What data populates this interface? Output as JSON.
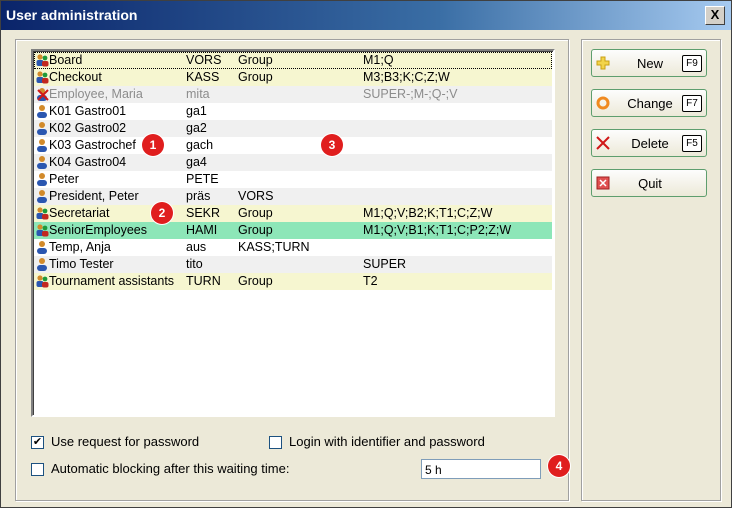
{
  "window": {
    "title": "User administration",
    "close_glyph": "X"
  },
  "users": [
    {
      "name": "Board",
      "id": "VORS",
      "type": "Group",
      "rights": "M1;Q",
      "icon": "group-icon",
      "style": "g",
      "sel": true
    },
    {
      "name": "Checkout",
      "id": "KASS",
      "type": "Group",
      "rights": "M3;B3;K;C;Z;W",
      "icon": "group-icon",
      "style": "g"
    },
    {
      "name": "Employee, Maria",
      "id": "mita",
      "type": "",
      "rights": "SUPER-;M-;Q-;V",
      "icon": "blocked-user-icon",
      "style": "s",
      "disabled": true
    },
    {
      "name": "K01 Gastro01",
      "id": "ga1",
      "type": "",
      "rights": "",
      "icon": "user-icon",
      "style": ""
    },
    {
      "name": "K02 Gastro02",
      "id": "ga2",
      "type": "",
      "rights": "",
      "icon": "user-icon",
      "style": "s"
    },
    {
      "name": "K03 Gastrochef",
      "id": "gach",
      "type": "",
      "rights": "",
      "icon": "user-icon",
      "style": ""
    },
    {
      "name": "K04 Gastro04",
      "id": "ga4",
      "type": "",
      "rights": "",
      "icon": "user-icon",
      "style": "s"
    },
    {
      "name": "Peter",
      "id": "PETE",
      "type": "",
      "rights": "",
      "icon": "user-icon",
      "style": ""
    },
    {
      "name": "President, Peter",
      "id": "präs",
      "type": "VORS",
      "rights": "",
      "icon": "user-icon",
      "style": "s"
    },
    {
      "name": "Secretariat",
      "id": "SEKR",
      "type": "Group",
      "rights": "M1;Q;V;B2;K;T1;C;Z;W",
      "icon": "group-icon",
      "style": "g"
    },
    {
      "name": "SeniorEmployees",
      "id": "HAMI",
      "type": "Group",
      "rights": "M1;Q;V;B1;K;T1;C;P2;Z;W",
      "icon": "group-icon",
      "style": "gr"
    },
    {
      "name": "Temp, Anja",
      "id": "aus",
      "type": "KASS;TURN",
      "rights": "",
      "icon": "user-icon",
      "style": ""
    },
    {
      "name": "Timo Tester",
      "id": "tito",
      "type": "",
      "rights": "SUPER",
      "icon": "user-icon",
      "style": "s"
    },
    {
      "name": "Tournament assistants",
      "id": "TURN",
      "type": "Group",
      "rights": "T2",
      "icon": "group-icon",
      "style": "g"
    }
  ],
  "badges": [
    "1",
    "2",
    "3",
    "4"
  ],
  "options": {
    "use_request_password": {
      "label": "Use request for password",
      "checked": true
    },
    "login_identifier": {
      "label": "Login with identifier and password",
      "checked": false
    },
    "auto_blocking": {
      "label": "Automatic blocking after this waiting time:",
      "checked": false
    },
    "wait_time": "5 h"
  },
  "buttons": {
    "new": {
      "label": "New",
      "key": "F9",
      "icon": "plus-icon"
    },
    "change": {
      "label": "Change",
      "key": "F7",
      "icon": "change-icon"
    },
    "delete": {
      "label": "Delete",
      "key": "F5",
      "icon": "delete-x-icon"
    },
    "quit": {
      "label": "Quit",
      "icon": "quit-icon"
    }
  },
  "colors": {
    "group_row": "#f6f6d0",
    "selected_group_row": "#8de6b8",
    "badge": "#e01e1e"
  }
}
